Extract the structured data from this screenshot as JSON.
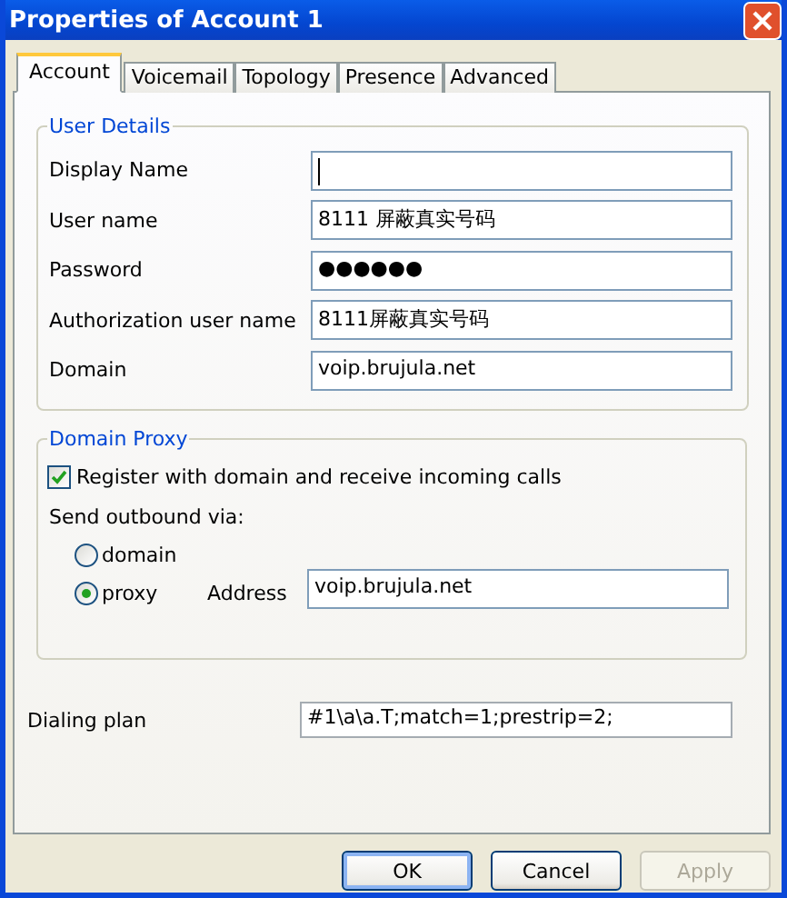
{
  "window": {
    "title": "Properties of Account 1"
  },
  "tabs": [
    {
      "label": "Account",
      "selected": true
    },
    {
      "label": "Voicemail",
      "selected": false
    },
    {
      "label": "Topology",
      "selected": false
    },
    {
      "label": "Presence",
      "selected": false
    },
    {
      "label": "Advanced",
      "selected": false
    }
  ],
  "user_details": {
    "title": "User Details",
    "fields": [
      {
        "label": "Display Name",
        "focused": true
      },
      {
        "label": "User name",
        "value": "8111 屏蔽真实号码",
        "focused": false
      },
      {
        "label": "Password",
        "value": "●●●●●●",
        "focused": false
      },
      {
        "label": "Authorization user name",
        "value": "8111屏蔽真实号码",
        "focused": false
      },
      {
        "label": "Domain",
        "value": "voip.brujula.net",
        "focused": false
      }
    ]
  },
  "domain_proxy": {
    "title": "Domain Proxy",
    "register": {
      "label": "Register with domain and receive incoming calls",
      "checked": true
    },
    "send_label": "Send outbound via:",
    "options": [
      {
        "label": "domain",
        "selected": false
      },
      {
        "label": "proxy",
        "selected": true
      }
    ],
    "address": {
      "label": "Address",
      "value": "voip.brujula.net"
    }
  },
  "dialing_plan": {
    "label": "Dialing plan",
    "value": "#1\\a\\a.T;match=1;prestrip=2;"
  },
  "buttons": [
    {
      "label": "OK",
      "default": true,
      "disabled": false
    },
    {
      "label": "Cancel",
      "default": false,
      "disabled": false
    },
    {
      "label": "Apply",
      "default": false,
      "disabled": true
    }
  ]
}
